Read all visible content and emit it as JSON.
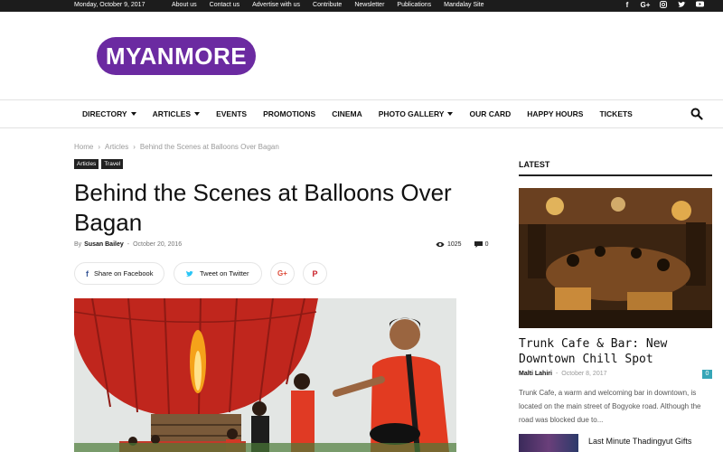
{
  "topbar": {
    "date": "Monday, October 9, 2017",
    "links": [
      "About us",
      "Contact us",
      "Advertise with us",
      "Contribute",
      "Newsletter",
      "Publications",
      "Mandalay Site"
    ],
    "social_icons": [
      "facebook-icon",
      "google-plus-icon",
      "instagram-icon",
      "twitter-icon",
      "youtube-icon"
    ]
  },
  "header": {
    "logo_text": "MYANMORE",
    "brand_color": "#6b2aa1"
  },
  "nav": {
    "items": [
      {
        "label": "DIRECTORY",
        "dropdown": true
      },
      {
        "label": "ARTICLES",
        "dropdown": true
      },
      {
        "label": "EVENTS",
        "dropdown": false
      },
      {
        "label": "PROMOTIONS",
        "dropdown": false
      },
      {
        "label": "CINEMA",
        "dropdown": false
      },
      {
        "label": "PHOTO GALLERY",
        "dropdown": true
      },
      {
        "label": "OUR CARD",
        "dropdown": false
      },
      {
        "label": "HAPPY HOURS",
        "dropdown": false
      },
      {
        "label": "TICKETS",
        "dropdown": false
      }
    ],
    "search_icon": "search-icon"
  },
  "breadcrumb": [
    "Home",
    "Articles",
    "Behind the Scenes at Balloons Over Bagan"
  ],
  "breadcrumb_sep": "›",
  "article": {
    "tags": [
      "Articles",
      "Travel"
    ],
    "title": "Behind the Scenes at Balloons Over Bagan",
    "by": "By",
    "author": "Susan Bailey",
    "date": "October 20, 2016",
    "views": "1025",
    "comments": "0"
  },
  "share": {
    "facebook": "Share on Facebook",
    "twitter": "Tweet on Twitter",
    "gplus_icon": "G+",
    "pinterest_icon": "P"
  },
  "sidebar": {
    "title": "LATEST",
    "main": {
      "headline": "Trunk Cafe & Bar: New Downtown Chill Spot",
      "author": "Malti Lahiri",
      "date": "October 8, 2017",
      "comments": "0",
      "excerpt": "Trunk Cafe, a warm and welcoming bar in downtown, is located on the main street of Bogyoke road. Although the road was blocked due to..."
    },
    "next_title": "Last Minute Thadingyut Gifts"
  },
  "colors": {
    "accent": "#36a6b7",
    "topbar_bg": "#1c1c1c"
  }
}
